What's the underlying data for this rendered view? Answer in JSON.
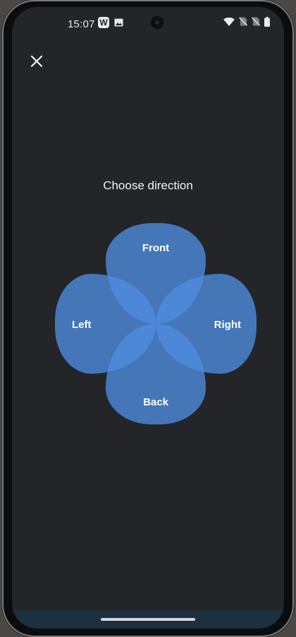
{
  "status_bar": {
    "time": "15:07",
    "notification_app_letter": "W",
    "icons": [
      "wifi-icon",
      "no-sim-icon",
      "no-sim-icon",
      "battery-icon"
    ]
  },
  "header": {
    "close_icon": "close-icon"
  },
  "main": {
    "title": "Choose direction",
    "directions": {
      "front": "Front",
      "left": "Left",
      "right": "Right",
      "back": "Back"
    }
  },
  "colors": {
    "background": "#232529",
    "petal_fill": "#4e8de0",
    "text": "#f1f2f4"
  }
}
